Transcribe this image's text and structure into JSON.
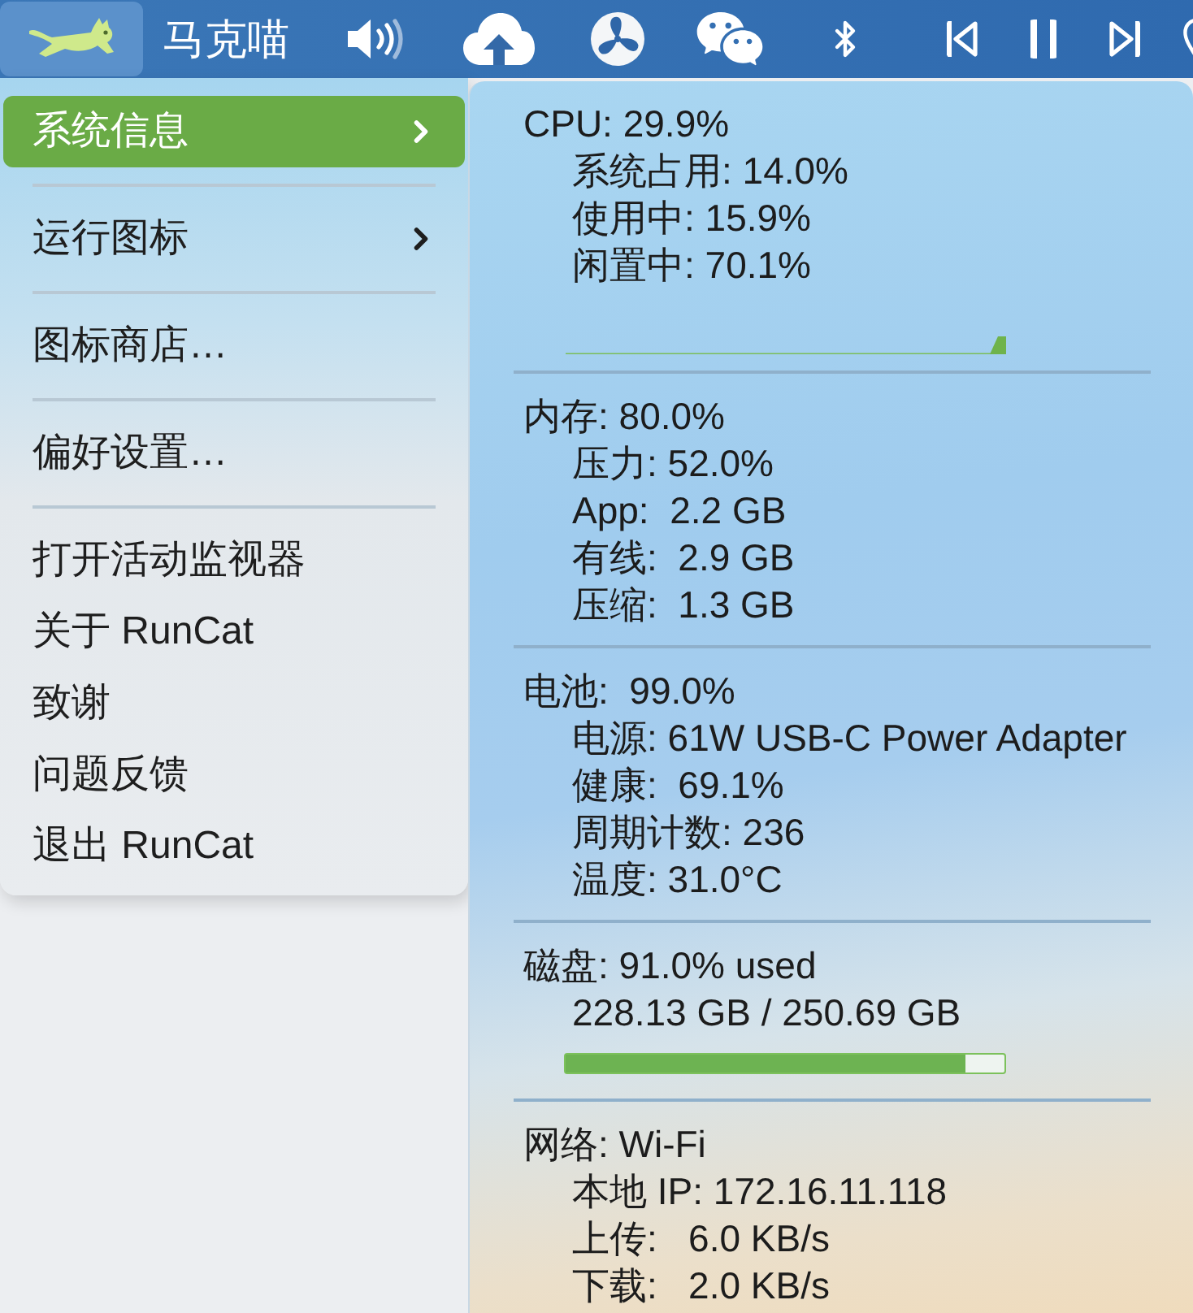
{
  "menu_bar": {
    "items": [
      {
        "kind": "cat",
        "selected": true
      },
      {
        "kind": "title",
        "label": "马克喵",
        "selected": false
      },
      {
        "kind": "volume",
        "selected": false
      },
      {
        "kind": "cloud",
        "selected": false
      },
      {
        "kind": "fan",
        "selected": false
      },
      {
        "kind": "wechat",
        "selected": false
      },
      {
        "kind": "bluetooth",
        "selected": false
      },
      {
        "kind": "previous",
        "selected": false
      },
      {
        "kind": "pause",
        "selected": false
      },
      {
        "kind": "next",
        "selected": false
      },
      {
        "kind": "pin",
        "selected": false
      }
    ]
  },
  "menu": {
    "groups": [
      {
        "items": [
          {
            "label": "系统信息",
            "selected": true,
            "submenu": true
          }
        ]
      },
      {
        "items": [
          {
            "label": "运行图标",
            "selected": false,
            "submenu": true
          }
        ]
      },
      {
        "items": [
          {
            "label": "图标商店…",
            "selected": false,
            "submenu": false
          }
        ]
      },
      {
        "items": [
          {
            "label": "偏好设置…",
            "selected": false,
            "submenu": false
          }
        ]
      },
      {
        "items": [
          {
            "label": "打开活动监视器",
            "selected": false,
            "submenu": false
          },
          {
            "label": "关于 RunCat",
            "selected": false,
            "submenu": false
          },
          {
            "label": "致谢",
            "selected": false,
            "submenu": false
          },
          {
            "label": "问题反馈",
            "selected": false,
            "submenu": false
          },
          {
            "label": "退出 RunCat",
            "selected": false,
            "submenu": false
          }
        ]
      }
    ]
  },
  "system_info": {
    "sections": [
      {
        "kind": "graph",
        "title": "CPU: 29.9%",
        "lines": [
          "系统占用: 14.0%",
          "使用中: 15.9%",
          "闲置中: 70.1%"
        ]
      },
      {
        "kind": "text",
        "title": "内存: 80.0%",
        "lines": [
          "压力: 52.0%",
          "App:  2.2 GB",
          "有线:  2.9 GB",
          "压缩:  1.3 GB"
        ]
      },
      {
        "kind": "text",
        "title": "电池:  99.0%",
        "lines": [
          "电源: 61W USB-C Power Adapter",
          "健康:  69.1%",
          "周期计数: 236",
          "温度: 31.0°C"
        ]
      },
      {
        "kind": "bar",
        "title": "磁盘: 91.0% used",
        "lines": [
          "228.13 GB / 250.69 GB"
        ],
        "level": 0.91
      },
      {
        "kind": "text",
        "title": "网络: Wi-Fi",
        "lines": [
          "本地 IP: 172.16.11.118",
          "上传:   6.0 KB/s",
          "下载:   2.0 KB/s"
        ]
      }
    ]
  }
}
